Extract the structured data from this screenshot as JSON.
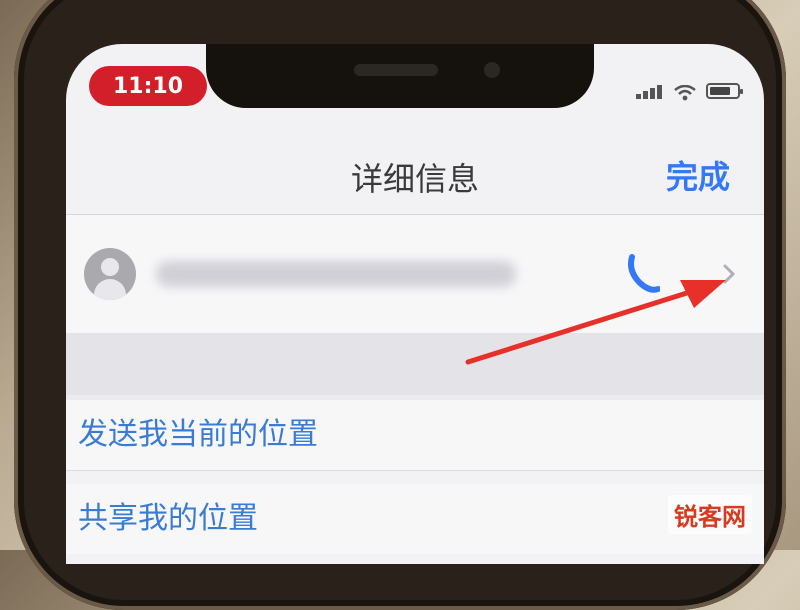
{
  "status_bar": {
    "time": "11:10"
  },
  "nav": {
    "title": "详细信息",
    "done_label": "完成"
  },
  "contact": {
    "number_blurred": true
  },
  "menu": {
    "send_location": "发送我当前的位置",
    "share_location": "共享我的位置"
  },
  "watermark": {
    "text": "锐客网"
  },
  "colors": {
    "accent": "#3478f6",
    "time_pill": "#d21f2a",
    "annotation_arrow": "#e8302a",
    "watermark": "#d83a1f"
  },
  "icons": {
    "phone": "phone-icon",
    "chevron": "chevron-right-icon",
    "avatar": "contact-avatar-icon",
    "signal": "signal-icon",
    "wifi": "wifi-icon",
    "battery": "battery-icon"
  }
}
